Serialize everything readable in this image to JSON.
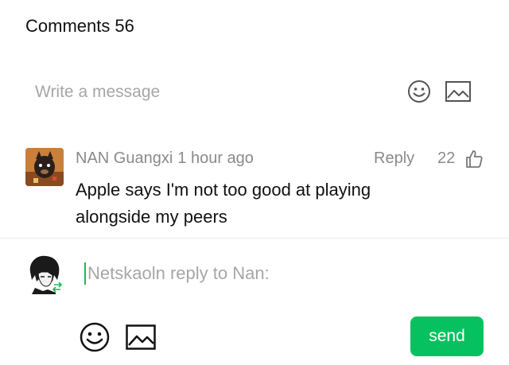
{
  "header": {
    "title": "Comments",
    "count": "56"
  },
  "compose": {
    "placeholder": "Write a message",
    "emoji_icon": "smiley-face-icon",
    "image_icon": "image-icon"
  },
  "comment": {
    "author": "NAN Guangxi",
    "time": "1 hour ago",
    "reply_label": "Reply",
    "likes": "22",
    "like_icon": "thumbs-up-icon",
    "text": "Apple says I'm not too good at playing alongside my peers"
  },
  "reply_box": {
    "placeholder": "Netskaoln reply to Nan:",
    "send_label": "send",
    "accent_color": "#07c160"
  }
}
